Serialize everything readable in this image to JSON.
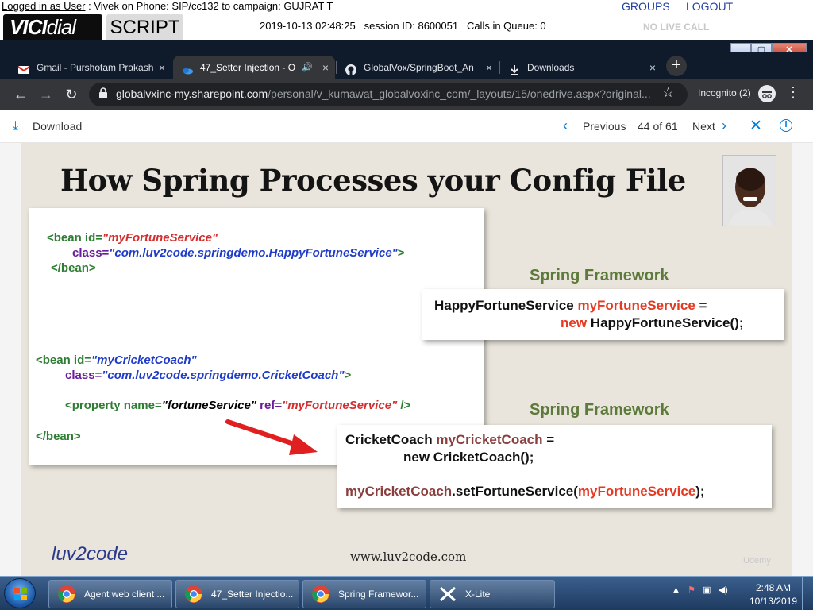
{
  "vici": {
    "logged_in_label": "Logged in as User",
    "login_info": " : Vivek on Phone: SIP/cc132  to campaign: GUJRAT  T",
    "groups": "GROUPS",
    "logout": "LOGOUT",
    "logo_bold": "VICI",
    "logo_rest": "dial",
    "script_tab": "SCRIPT",
    "datetime": "2019-10-13 02:48:25",
    "session": "session ID: 8600051",
    "queue": "Calls in Queue: 0",
    "no_live_call": "NO LIVE CALL"
  },
  "chrome": {
    "tabs": [
      {
        "label": "Gmail - Purshotam Prakash",
        "icon": "gmail-icon"
      },
      {
        "label": "47_Setter Injection - O",
        "icon": "onedrive-icon",
        "active": true
      },
      {
        "label": "GlobalVox/SpringBoot_An",
        "icon": "github-icon"
      },
      {
        "label": "Downloads",
        "icon": "download-icon"
      }
    ],
    "close_glyph": "×",
    "new_tab": "+",
    "url_host": "globalvxinc-my.sharepoint.com",
    "url_path": "/personal/v_kumawat_globalvoxinc_com/_layouts/15/onedrive.aspx?original...",
    "incognito": "Incognito (2)"
  },
  "viewer": {
    "download": "Download",
    "previous": "Previous",
    "page": "44 of 61",
    "next": "Next"
  },
  "slide": {
    "title": "How Spring Processes your Config File",
    "bean1": {
      "line1_open": "<bean id=",
      "line1_val": "\"myFortuneService\"",
      "line2_attr": "class=",
      "line2_val": "\"com.luv2code.springdemo.HappyFortuneService\"",
      "line2_close": ">",
      "line3": "</bean>"
    },
    "bean2": {
      "line1_open": "<bean id=",
      "line1_val": "\"myCricketCoach\"",
      "line2_attr": "class=",
      "line2_val": "\"com.luv2code.springdemo.CricketCoach\"",
      "line2_close": ">",
      "prop_open": "<property name=",
      "prop_name": "\"fortuneService\"",
      "prop_ref": " ref=",
      "prop_ref_val": "\"myFortuneService\"",
      "prop_close": " />",
      "line4": "</bean>"
    },
    "spring_framework_1": "Spring Framework",
    "spring_framework_2": "Spring Framework",
    "java1": {
      "type": "HappyFortuneService ",
      "var": "myFortuneService",
      "eq": " =",
      "new_kw": "new",
      "ctor": " HappyFortuneService();"
    },
    "java2": {
      "line1_type": "CricketCoach ",
      "line1_var": "myCricketCoach",
      "line1_eq": " =",
      "line2": "new CricketCoach();",
      "line3_obj": "myCricketCoach",
      "line3_call": ".setFortuneService(",
      "line3_arg": "myFortuneService",
      "line3_end": ");"
    },
    "footer_url": "www.luv2code.com",
    "logo": "luv2code",
    "udemy": "Udemy"
  },
  "taskbar": {
    "items": [
      {
        "label": "Agent web client ...",
        "icon": "chrome-icon"
      },
      {
        "label": "47_Setter Injectio...",
        "icon": "chrome-icon"
      },
      {
        "label": "Spring Framewor...",
        "icon": "chrome-icon"
      },
      {
        "label": "X-Lite",
        "icon": "xlite-icon"
      }
    ],
    "time": "2:48 AM",
    "date": "10/13/2019"
  },
  "colors": {
    "chrome_dark": "#35363a",
    "accent_blue": "#0078d4",
    "code_green": "#2e7d32",
    "code_red": "#d32f2f",
    "code_blue": "#1e3cc8",
    "spring_green": "#5c7a3a",
    "java_red": "#e53922"
  }
}
